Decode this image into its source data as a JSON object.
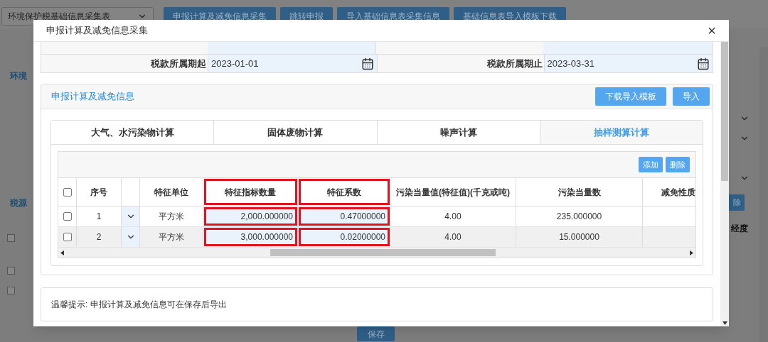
{
  "background": {
    "select": "环境保护税基础信息采集表",
    "buttons": [
      "申报计算及减免信息采集",
      "跳转申报",
      "导入基础信息表采集信息",
      "基础信息表导入模板下载"
    ],
    "section_titles": [
      "环境",
      "税源"
    ],
    "checkboxes": [
      {
        "checked": false
      },
      {
        "checked": false
      },
      {
        "checked": false
      }
    ],
    "side_button": "除",
    "side_column": "经度",
    "save_button": "保存"
  },
  "dialog": {
    "title": "申报计算及减免信息采集",
    "close": "×",
    "date_fields": [
      {
        "label": "税款所属期起",
        "value": "2023-01-01"
      },
      {
        "label": "税款所属期止",
        "value": "2023-03-31"
      }
    ],
    "section": {
      "title": "申报计算及减免信息",
      "buttons": [
        "下载导入模板",
        "导入"
      ],
      "tabs": [
        {
          "label": "大气、水污染物计算",
          "selected": false
        },
        {
          "label": "固体废物计算",
          "selected": false
        },
        {
          "label": "噪声计算",
          "selected": false
        },
        {
          "label": "抽样测算计算",
          "selected": true
        }
      ],
      "toolbar": [
        "添加",
        "删除"
      ],
      "table": {
        "select_all_checked": false,
        "columns": [
          {
            "label": "序号",
            "kind": "text",
            "highlighted": false
          },
          {
            "kind": "dropdown",
            "highlighted": false
          },
          {
            "label": "特征单位",
            "kind": "text",
            "highlighted": false
          },
          {
            "label": "特征指标数量",
            "kind": "input",
            "highlighted": true
          },
          {
            "label": "特征系数",
            "kind": "input",
            "highlighted": true
          },
          {
            "label": "污染当量值(特征值)(千克或吨)",
            "kind": "text",
            "highlighted": false
          },
          {
            "label": "污染当量数",
            "kind": "text",
            "highlighted": false
          },
          {
            "label": "减免性质",
            "kind": "text",
            "highlighted": false
          }
        ],
        "rows": [
          {
            "checked": false,
            "cells": [
              "1",
              "",
              "平方米",
              "2,000.000000",
              "0.47000000",
              "4.00",
              "235.000000",
              ""
            ]
          },
          {
            "checked": false,
            "cells": [
              "2",
              "",
              "平方米",
              "3,000.000000",
              "0.02000000",
              "4.00",
              "15.000000",
              ""
            ]
          }
        ]
      }
    },
    "notice": "温馨提示: 申报计算及减免信息可在保存后导出"
  }
}
